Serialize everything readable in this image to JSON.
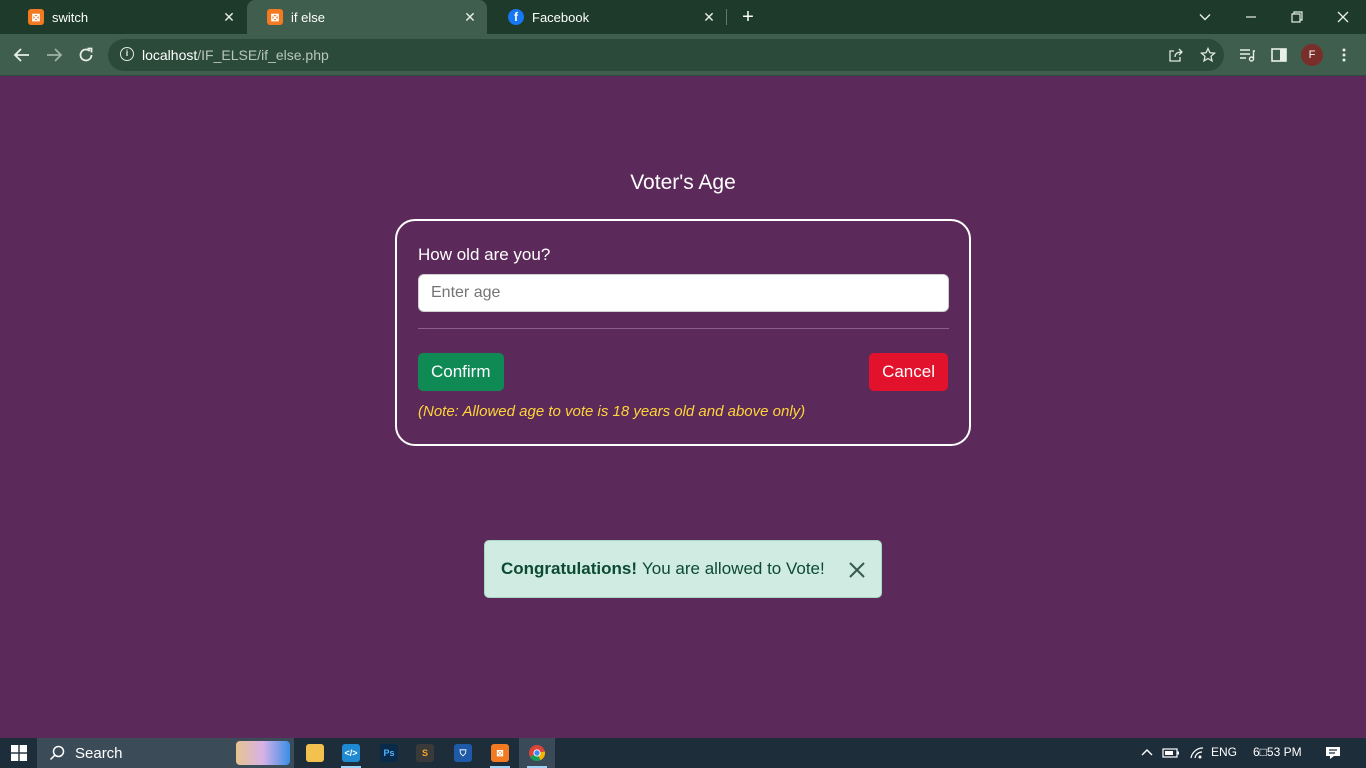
{
  "browser": {
    "tabs": [
      {
        "title": "switch",
        "favicon": "xampp-icon",
        "active": false
      },
      {
        "title": "if else",
        "favicon": "xampp-icon",
        "active": true
      },
      {
        "title": "Facebook",
        "favicon": "facebook-icon",
        "active": false
      }
    ],
    "url_host": "localhost",
    "url_path": "/IF_ELSE/if_else.php",
    "profile_initial": "F"
  },
  "page": {
    "title": "Voter's Age",
    "question": "How old are you?",
    "age_placeholder": "Enter age",
    "age_value": "",
    "confirm_label": "Confirm",
    "cancel_label": "Cancel",
    "note": "(Note: Allowed age to vote is 18 years old and above only)",
    "alert": {
      "strong": "Congratulations!",
      "message": "You are allowed to Vote!"
    }
  },
  "taskbar": {
    "search_label": "Search",
    "language": "ENG",
    "time": "6□53 PM"
  },
  "colors": {
    "page_background": "#5b2a5a",
    "confirm": "#0f8a55",
    "cancel": "#e3122c",
    "note": "#ffd43a",
    "alert_background": "#d0ebe1",
    "browser_frame": "#3f5e4d"
  }
}
